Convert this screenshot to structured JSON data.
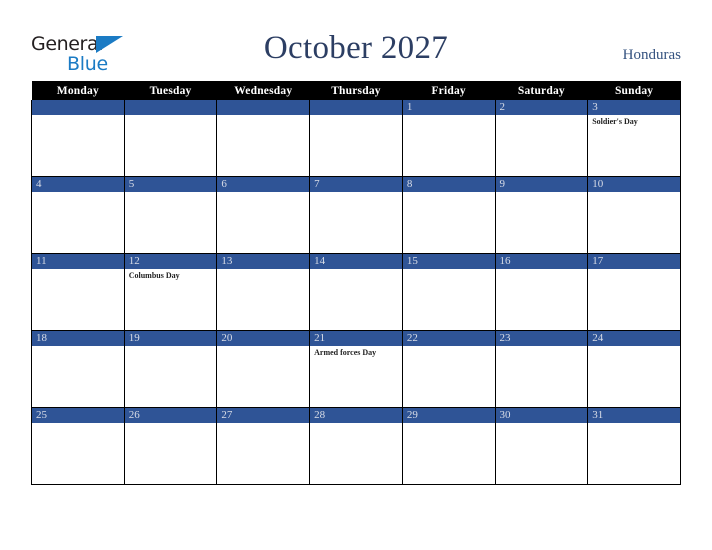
{
  "logo": {
    "word_one": "General",
    "word_two": "Blue",
    "triangle_icon": "triangle-icon",
    "accent_color": "#1b7bc4"
  },
  "header": {
    "title": "October 2027",
    "country": "Honduras",
    "title_color": "#2c3e63"
  },
  "calendar": {
    "weekday_headers": [
      "Monday",
      "Tuesday",
      "Wednesday",
      "Thursday",
      "Friday",
      "Saturday",
      "Sunday"
    ],
    "header_bg": "#000000",
    "daynum_bg": "#2f5496",
    "weeks": [
      [
        {
          "day": "",
          "event": ""
        },
        {
          "day": "",
          "event": ""
        },
        {
          "day": "",
          "event": ""
        },
        {
          "day": "",
          "event": ""
        },
        {
          "day": "1",
          "event": ""
        },
        {
          "day": "2",
          "event": ""
        },
        {
          "day": "3",
          "event": "Soldier's Day"
        }
      ],
      [
        {
          "day": "4",
          "event": ""
        },
        {
          "day": "5",
          "event": ""
        },
        {
          "day": "6",
          "event": ""
        },
        {
          "day": "7",
          "event": ""
        },
        {
          "day": "8",
          "event": ""
        },
        {
          "day": "9",
          "event": ""
        },
        {
          "day": "10",
          "event": ""
        }
      ],
      [
        {
          "day": "11",
          "event": ""
        },
        {
          "day": "12",
          "event": "Columbus Day"
        },
        {
          "day": "13",
          "event": ""
        },
        {
          "day": "14",
          "event": ""
        },
        {
          "day": "15",
          "event": ""
        },
        {
          "day": "16",
          "event": ""
        },
        {
          "day": "17",
          "event": ""
        }
      ],
      [
        {
          "day": "18",
          "event": ""
        },
        {
          "day": "19",
          "event": ""
        },
        {
          "day": "20",
          "event": ""
        },
        {
          "day": "21",
          "event": "Armed forces Day"
        },
        {
          "day": "22",
          "event": ""
        },
        {
          "day": "23",
          "event": ""
        },
        {
          "day": "24",
          "event": ""
        }
      ],
      [
        {
          "day": "25",
          "event": ""
        },
        {
          "day": "26",
          "event": ""
        },
        {
          "day": "27",
          "event": ""
        },
        {
          "day": "28",
          "event": ""
        },
        {
          "day": "29",
          "event": ""
        },
        {
          "day": "30",
          "event": ""
        },
        {
          "day": "31",
          "event": ""
        }
      ]
    ]
  }
}
